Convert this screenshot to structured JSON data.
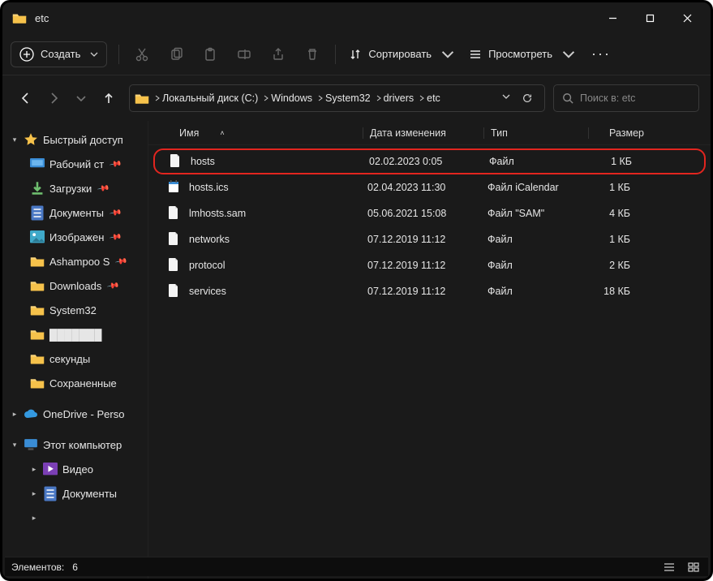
{
  "title": "etc",
  "toolbar": {
    "create_label": "Создать",
    "sort_label": "Сортировать",
    "view_label": "Просмотреть"
  },
  "breadcrumb": {
    "segments": [
      "Локальный диск (C:)",
      "Windows",
      "System32",
      "drivers",
      "etc"
    ]
  },
  "search": {
    "placeholder": "Поиск в: etc"
  },
  "sidebar": {
    "quick_access": "Быстрый доступ",
    "items": [
      {
        "label": "Рабочий ст",
        "icon": "desktop",
        "pinned": true
      },
      {
        "label": "Загрузки",
        "icon": "download",
        "pinned": true
      },
      {
        "label": "Документы",
        "icon": "doc",
        "pinned": true
      },
      {
        "label": "Изображен",
        "icon": "picture",
        "pinned": true
      },
      {
        "label": "Ashampoo S",
        "icon": "folder",
        "pinned": true
      },
      {
        "label": "Downloads",
        "icon": "folder",
        "pinned": true
      },
      {
        "label": "System32",
        "icon": "folder",
        "pinned": false
      },
      {
        "label": "",
        "icon": "folder",
        "pinned": false,
        "blurred": true
      },
      {
        "label": "секунды",
        "icon": "folder",
        "pinned": false
      },
      {
        "label": "Сохраненные",
        "icon": "folder",
        "pinned": false
      }
    ],
    "onedrive": "OneDrive - Perso",
    "this_pc": "Этот компьютер",
    "pc_items": [
      {
        "label": "Видео",
        "icon": "video"
      },
      {
        "label": "Документы",
        "icon": "doc"
      }
    ]
  },
  "columns": {
    "name": "Имя",
    "date": "Дата изменения",
    "type": "Тип",
    "size": "Размер"
  },
  "files": [
    {
      "name": "hosts",
      "date": "02.02.2023 0:05",
      "type": "Файл",
      "size": "1 КБ",
      "icon": "file-blank",
      "highlight": true
    },
    {
      "name": "hosts.ics",
      "date": "02.04.2023 11:30",
      "type": "Файл iCalendar",
      "size": "1 КБ",
      "icon": "file-cal"
    },
    {
      "name": "lmhosts.sam",
      "date": "05.06.2021 15:08",
      "type": "Файл \"SAM\"",
      "size": "4 КБ",
      "icon": "file-blank"
    },
    {
      "name": "networks",
      "date": "07.12.2019 11:12",
      "type": "Файл",
      "size": "1 КБ",
      "icon": "file-blank"
    },
    {
      "name": "protocol",
      "date": "07.12.2019 11:12",
      "type": "Файл",
      "size": "2 КБ",
      "icon": "file-blank"
    },
    {
      "name": "services",
      "date": "07.12.2019 11:12",
      "type": "Файл",
      "size": "18 КБ",
      "icon": "file-blank"
    }
  ],
  "status": {
    "elements_label": "Элементов:",
    "count": "6"
  }
}
